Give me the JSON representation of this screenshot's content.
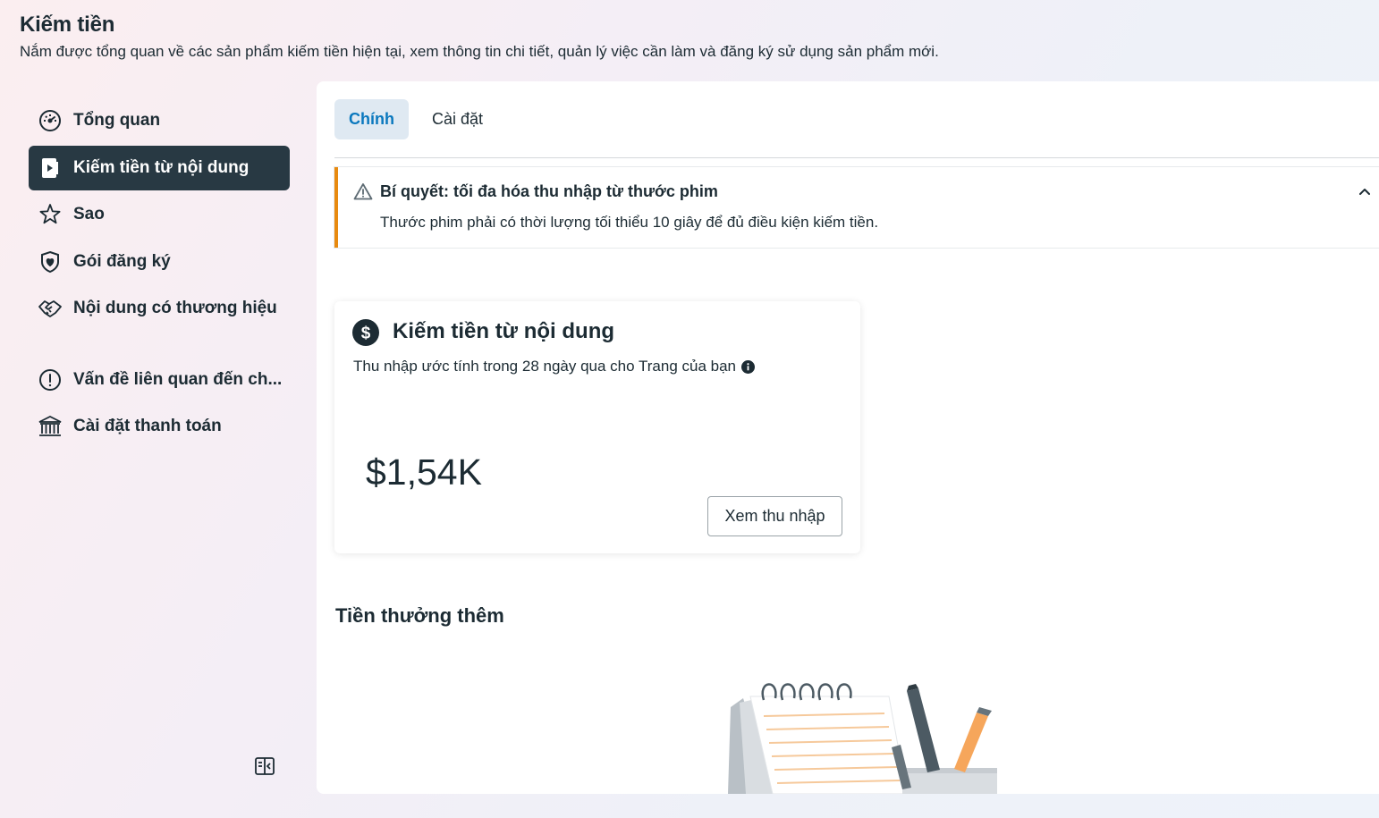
{
  "header": {
    "title": "Kiếm tiền",
    "subtitle": "Nắm được tổng quan về các sản phẩm kiếm tiền hiện tại, xem thông tin chi tiết, quản lý việc cần làm và đăng ký sử dụng sản phẩm mới."
  },
  "sidebar": {
    "items": [
      {
        "label": "Tổng quan",
        "icon": "dashboard-gauge-icon"
      },
      {
        "label": "Kiếm tiền từ nội dung",
        "icon": "video-play-icon",
        "active": true
      },
      {
        "label": "Sao",
        "icon": "star-icon"
      },
      {
        "label": "Gói đăng ký",
        "icon": "shield-heart-icon"
      },
      {
        "label": "Nội dung có thương hiệu",
        "icon": "handshake-icon"
      }
    ],
    "secondary_items": [
      {
        "label": "Vấn đề liên quan đến ch...",
        "icon": "alert-circle-icon"
      },
      {
        "label": "Cài đặt thanh toán",
        "icon": "bank-icon"
      }
    ],
    "collapse_icon": "sidebar-collapse-icon"
  },
  "tabs": [
    {
      "label": "Chính",
      "active": true
    },
    {
      "label": "Cài đặt",
      "active": false
    }
  ],
  "tip": {
    "title": "Bí quyết: tối đa hóa thu nhập từ thước phim",
    "body": "Thước phim phải có thời lượng tối thiểu 10 giây để đủ điều kiện kiếm tiền.",
    "icon": "warning-triangle-icon",
    "accent_color": "#e88a0f"
  },
  "earnings_card": {
    "title": "Kiếm tiền từ nội dung",
    "subtitle": "Thu nhập ước tính trong 28 ngày qua cho Trang của bạn",
    "amount": "$1,54K",
    "button_label": "Xem thu nhập"
  },
  "bonus_section": {
    "title": "Tiền thưởng thêm"
  },
  "colors": {
    "active_nav_bg": "#283943",
    "active_tab_text": "#0a78be",
    "active_tab_bg": "#dfe9f2"
  }
}
